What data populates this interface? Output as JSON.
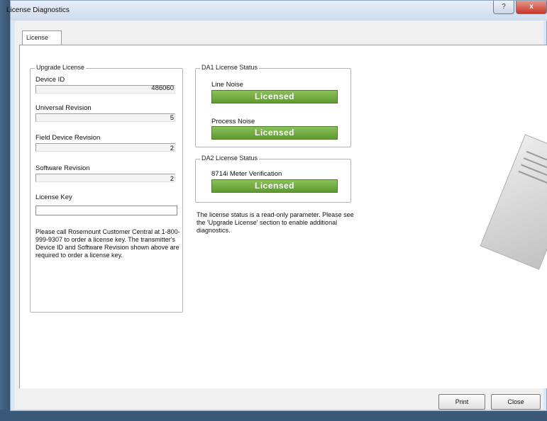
{
  "window": {
    "title": "License Diagnostics",
    "help_label": "?",
    "close_label": "x"
  },
  "tabs": [
    {
      "label": "License"
    }
  ],
  "upgrade_license": {
    "legend": "Upgrade License",
    "device_id": {
      "label": "Device ID",
      "value": "486060"
    },
    "universal_revision": {
      "label": "Universal Revision",
      "value": "5"
    },
    "field_device_revision": {
      "label": "Field Device Revision",
      "value": "2"
    },
    "software_revision": {
      "label": "Software Revision",
      "value": "2"
    },
    "license_key": {
      "label": "License Key",
      "value": ""
    },
    "instructions": "Please call Rosemount Customer Central at 1-800-999-9307 to order a license key. The transmitter's Device ID and Software Revision shown above are required to order a license key."
  },
  "da1": {
    "legend": "DA1 License Status",
    "line_noise": {
      "label": "Line Noise",
      "status": "Licensed"
    },
    "process_noise": {
      "label": "Process Noise",
      "status": "Licensed"
    }
  },
  "da2": {
    "legend": "DA2 License Status",
    "meter_verification": {
      "label": "8714i Meter Verification",
      "status": "Licensed"
    }
  },
  "status_note": "The license status is a read-only parameter. Please see the 'Upgrade License' section to enable additional diagnostics.",
  "buttons": {
    "print": "Print",
    "close": "Close"
  },
  "colors": {
    "licensed_green": "#6aa73a",
    "window_frame": "#dde7f1"
  }
}
